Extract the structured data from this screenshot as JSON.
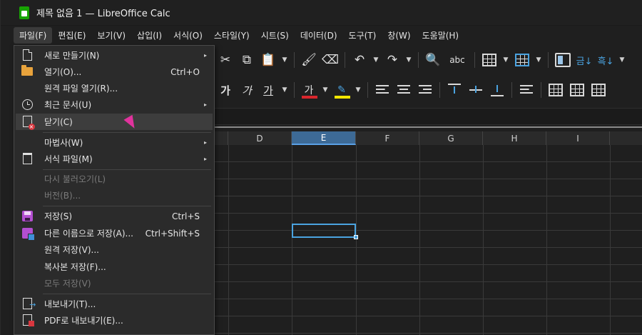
{
  "window": {
    "title": "제목 없음 1 — LibreOffice Calc"
  },
  "menubar": {
    "items": [
      "파일(F)",
      "편집(E)",
      "보기(V)",
      "삽입(I)",
      "서식(O)",
      "스타일(Y)",
      "시트(S)",
      "데이터(D)",
      "도구(T)",
      "창(W)",
      "도움말(H)"
    ]
  },
  "toolbar": {
    "format_bold": "가",
    "format_italic": "가",
    "format_underline": "가",
    "font_color_glyph": "가",
    "font_color": "#d9262c",
    "highlight_color": "#f2e600",
    "spellcheck_label": "abc",
    "sort_asc_glyph": "금↓",
    "sort_desc_glyph": "흑↓"
  },
  "sheet": {
    "columns": [
      "D",
      "E",
      "F",
      "G",
      "H",
      "I"
    ],
    "selected_column": "E",
    "selection_color": "#4aa3e0"
  },
  "file_menu": {
    "items": [
      {
        "icon": "new-document-icon",
        "label": "새로 만들기(N)",
        "shortcut": "",
        "submenu": true,
        "disabled": false
      },
      {
        "icon": "open-folder-icon",
        "label": "열기(O)...",
        "shortcut": "Ctrl+O",
        "submenu": false,
        "disabled": false
      },
      {
        "icon": "",
        "label": "원격 파일 열기(R)...",
        "shortcut": "",
        "submenu": false,
        "disabled": false
      },
      {
        "icon": "clock-icon",
        "label": "최근 문서(U)",
        "shortcut": "",
        "submenu": true,
        "disabled": false
      },
      {
        "icon": "close-document-icon",
        "label": "닫기(C)",
        "shortcut": "",
        "submenu": false,
        "disabled": false,
        "hover": true
      },
      {
        "icon": "",
        "label": "마법사(W)",
        "shortcut": "",
        "submenu": true,
        "disabled": false
      },
      {
        "icon": "template-icon",
        "label": "서식 파일(M)",
        "shortcut": "",
        "submenu": true,
        "disabled": false
      },
      {
        "icon": "",
        "label": "다시 불러오기(L)",
        "shortcut": "",
        "submenu": false,
        "disabled": true
      },
      {
        "icon": "",
        "label": "버전(B)...",
        "shortcut": "",
        "submenu": false,
        "disabled": true
      },
      {
        "icon": "save-icon",
        "label": "저장(S)",
        "shortcut": "Ctrl+S",
        "submenu": false,
        "disabled": false
      },
      {
        "icon": "save-as-icon",
        "label": "다른 이름으로 저장(A)...",
        "shortcut": "Ctrl+Shift+S",
        "submenu": false,
        "disabled": false
      },
      {
        "icon": "",
        "label": "원격 저장(V)...",
        "shortcut": "",
        "submenu": false,
        "disabled": false
      },
      {
        "icon": "",
        "label": "복사본 저장(F)...",
        "shortcut": "",
        "submenu": false,
        "disabled": false
      },
      {
        "icon": "",
        "label": "모두 저장(V)",
        "shortcut": "",
        "submenu": false,
        "disabled": true
      },
      {
        "icon": "export-icon",
        "label": "내보내기(T)...",
        "shortcut": "",
        "submenu": false,
        "disabled": false
      },
      {
        "icon": "pdf-icon",
        "label": "PDF로 내보내기(E)...",
        "shortcut": "",
        "submenu": false,
        "disabled": false
      }
    ]
  },
  "colors": {
    "accent": "#4aa3e0",
    "menu_bg": "#2b2b2b",
    "app_icon": "#18a303",
    "cursor": "#e0339d"
  }
}
